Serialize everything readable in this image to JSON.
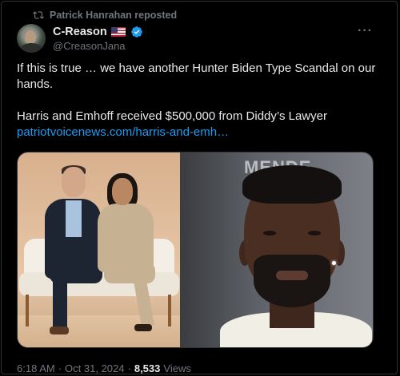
{
  "reposted_by": "Patrick Hanrahan reposted",
  "author": {
    "display_name": "C-Reason",
    "handle": "@CreasonJana"
  },
  "more_label": "···",
  "post": {
    "line1": "If this is true … we have another Hunter Biden Type Scandal on our hands.",
    "line2": "Harris and Emhoff received $500,000 from Diddy’s Lawyer",
    "link_text": "patriotvoicenews.com/harris-and-emh…"
  },
  "media": {
    "backdrop_text": "MENDE"
  },
  "meta": {
    "time": "6:18 AM",
    "separator1": "·",
    "date": "Oct 31, 2024",
    "separator2": "·",
    "views_count": "8,533",
    "views_label": "Views"
  },
  "colors": {
    "link": "#1d9bf0",
    "secondary_text": "#71767b",
    "verified": "#1d9bf0"
  },
  "icons": {
    "repost": "repost-icon",
    "verified": "verified-badge-icon",
    "flag": "us-flag-icon"
  }
}
